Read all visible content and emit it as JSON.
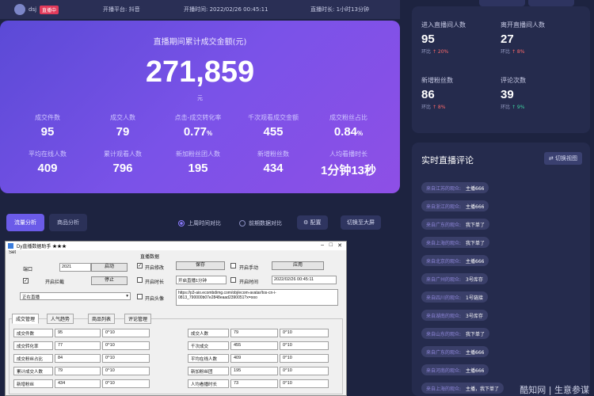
{
  "topbar": {
    "name": "dsj",
    "badge": "直播中",
    "platform": "开播平台: 抖音",
    "start_time": "开播时间: 2022/02/26 00:45:11",
    "duration": "直播时长: 1小时13分钟"
  },
  "hero": {
    "title": "直播期间累计成交金额(元)",
    "value": "271,859",
    "unit": "元",
    "stats": [
      {
        "label": "成交件数",
        "value": "95",
        "suffix": ""
      },
      {
        "label": "成交人数",
        "value": "79",
        "suffix": ""
      },
      {
        "label": "点击-成交转化率",
        "value": "0.77",
        "suffix": "%"
      },
      {
        "label": "千次观看成交金额",
        "value": "455",
        "suffix": ""
      },
      {
        "label": "成交粉丝占比",
        "value": "0.84",
        "suffix": "%"
      },
      {
        "label": "平均在线人数",
        "value": "409",
        "suffix": ""
      },
      {
        "label": "累计观看人数",
        "value": "796",
        "suffix": ""
      },
      {
        "label": "新加粉丝团人数",
        "value": "195",
        "suffix": ""
      },
      {
        "label": "新增粉丝数",
        "value": "434",
        "suffix": ""
      },
      {
        "label": "人均看播时长",
        "value": "1分钟13秒",
        "suffix": ""
      }
    ]
  },
  "lower_tabs": {
    "tab1": "流量分析",
    "tab2": "商品分析",
    "radio1": "上周时间对比",
    "radio2": "前期数据对比",
    "config": "配置",
    "fullscreen": "切换至大屏"
  },
  "right": {
    "stats": [
      {
        "label": "进入直播间人数",
        "value": "95",
        "change_label": "环比",
        "change": "↑ 20%"
      },
      {
        "label": "离开直播间人数",
        "value": "27",
        "change_label": "环比",
        "change": "↑ 8%"
      },
      {
        "label": "新增粉丝数",
        "value": "86",
        "change_label": "环比",
        "change": "↑ 8%"
      },
      {
        "label": "评论次数",
        "value": "39",
        "change_label": "环比",
        "change": "↑ 9%"
      }
    ],
    "comments_title": "实时直播评论",
    "comments_button": "切换视图",
    "comments": [
      {
        "user": "来自江苏的观众:",
        "text": "主播666"
      },
      {
        "user": "来自浙江的观众:",
        "text": "主播666"
      },
      {
        "user": "来自广东的观众:",
        "text": "我下单了"
      },
      {
        "user": "来自上海的观众:",
        "text": "我下单了"
      },
      {
        "user": "来自北京的观众:",
        "text": "主播666"
      },
      {
        "user": "来自广州的观众:",
        "text": "3号库存"
      },
      {
        "user": "来自四川的观众:",
        "text": "1号链接"
      },
      {
        "user": "来自湖南的观众:",
        "text": "3号库存"
      },
      {
        "user": "来自山东的观众:",
        "text": "我下单了"
      },
      {
        "user": "来自广东的观众:",
        "text": "主播666"
      },
      {
        "user": "来自河南的观众:",
        "text": "主播666"
      },
      {
        "user": "来自上海的观众:",
        "text": "主播，我下单了"
      }
    ]
  },
  "dialog": {
    "title": "Dy直播数据助手 ★★★",
    "menu": "Set",
    "port_label": "端口",
    "port_value": "2021",
    "start_btn": "启动",
    "stop_btn": "停止",
    "cb_enable": "开启拦截",
    "status_label": "正在直播",
    "group_title": "直播数据",
    "cb_modify": "开启修改",
    "btn_save": "保存",
    "cb_monitor": "开启手动",
    "btn_apply": "应用",
    "cb_fake_time": "开启时长",
    "fake_time_value": "开启直播1分钟",
    "cb_time_reset": "开启时间",
    "time_value": "2022/02/26 00:45:11",
    "cb_avatar": "开启头像",
    "url_value": "https://p3-aio.ecombdimg.com/obj/ecom-avatar/tos-cn-i-0813_790000b07e2848eaad2390051?x=ooo",
    "tabs": [
      "成交管理",
      "人气趋势",
      "商品列表",
      "评论管理"
    ],
    "rows_left": [
      {
        "label": "成交件数",
        "value": "95",
        "op": "0^10"
      },
      {
        "label": "成交转化率",
        "value": "77",
        "op": "0^10"
      },
      {
        "label": "成交粉丝占比",
        "value": "84",
        "op": "0^10"
      },
      {
        "label": "累计成交人数",
        "value": "79",
        "op": "0^10"
      },
      {
        "label": "新增粉丝",
        "value": "434",
        "op": "0^10"
      }
    ],
    "rows_right": [
      {
        "label": "成交人数",
        "value": "79",
        "op": "0^10"
      },
      {
        "label": "千次成交",
        "value": "455",
        "op": "0^10"
      },
      {
        "label": "平均在线人数",
        "value": "409",
        "op": "0^10"
      },
      {
        "label": "新加粉丝团",
        "value": "195",
        "op": "0^10"
      },
      {
        "label": "人均看播时长",
        "value": "73",
        "op": "0^10"
      }
    ]
  },
  "watermark": "酷知网 | 生意参谋"
}
